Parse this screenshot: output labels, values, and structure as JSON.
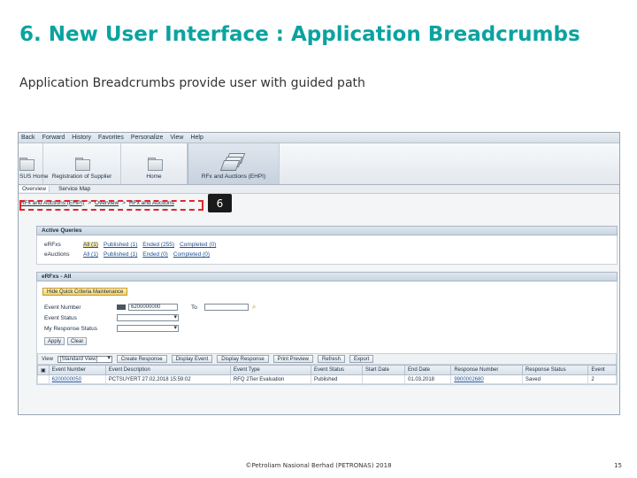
{
  "slide": {
    "title": "6. New User Interface : Application Breadcrumbs",
    "subtitle": "Application Breadcrumbs provide user with guided path",
    "footer": "©Petroliam Nasional Berhad (PETRONAS) 2018",
    "page_number": "15",
    "callout": "6",
    "accent_color": "#0aa3a0"
  },
  "menu": [
    "Back",
    "Forward",
    "History",
    "Favorites",
    "Personalize",
    "View",
    "Help"
  ],
  "nav_items": [
    "SUS Home",
    "Registration of Supplier",
    "Home",
    "RFx and Auctions (EHPI)"
  ],
  "subnav": [
    "Overview",
    "Service Map"
  ],
  "breadcrumb": [
    "RFx and Auctions (EHPI)",
    "Overview",
    "RFx and Auctions"
  ],
  "breadcrumb_sep": ">",
  "active_queries": {
    "title": "Active Queries",
    "rows": [
      {
        "label": "eRFxs",
        "links": [
          "All (1)",
          "Published (1)",
          "Ended (255)",
          "Completed (0)"
        ]
      },
      {
        "label": "eAuctions",
        "links": [
          "All (1)",
          "Published (1)",
          "Ended (0)",
          "Completed (0)"
        ]
      }
    ]
  },
  "list_title": "eRFxs - All",
  "hide_btn": "Hide Quick Criteria Maintenance",
  "form": {
    "event_number_label": "Event Number",
    "event_number_value": "6200000000",
    "to_label": "To",
    "event_status_label": "Event Status",
    "my_response_label": "My Response Status",
    "apply": "Apply",
    "clear": "Clear"
  },
  "toolbar": {
    "view_label": "View",
    "view_value": "[Standard View]",
    "buttons": [
      "Create Response",
      "Display Event",
      "Display Response",
      "Print Preview",
      "Refresh",
      "Export"
    ]
  },
  "table": {
    "headers": [
      "Event Number",
      "Event Description",
      "Event Type",
      "Event Status",
      "Start Date",
      "End Date",
      "Response Number",
      "Response Status",
      "Event"
    ],
    "rows": [
      [
        "6200000050",
        "PCTSUYERT 27.02.2018 15:59:02",
        "RFQ 2Tier Evaluation",
        "Published",
        "",
        "01.03.2018",
        "9900002680",
        "Saved",
        "2"
      ]
    ]
  }
}
